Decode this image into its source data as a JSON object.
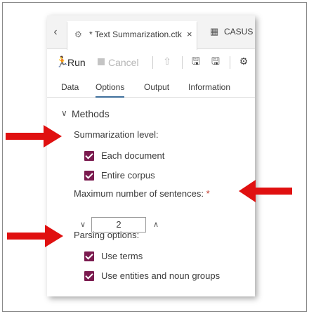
{
  "tabbar": {
    "prev_glyph": "‹",
    "active_tab": {
      "icon": "gear-doc-icon",
      "label": "* Text Summarization.ctk",
      "close_glyph": "×"
    },
    "second_tab": {
      "icon": "table-doc-icon",
      "label": "CASUS"
    }
  },
  "toolbar": {
    "run_label": "Run",
    "cancel_label": "Cancel",
    "icons": [
      "upload-icon",
      "save-icon",
      "save-as-icon",
      "settings-icon"
    ]
  },
  "subtabs": [
    {
      "label": "Data",
      "active": false
    },
    {
      "label": "Options",
      "active": true
    },
    {
      "label": "Output",
      "active": false
    },
    {
      "label": "Information",
      "active": false
    }
  ],
  "options": {
    "section_label": "Methods",
    "summarization_level": {
      "label": "Summarization level:",
      "choices": [
        {
          "label": "Each document",
          "checked": true
        },
        {
          "label": "Entire corpus",
          "checked": true
        }
      ]
    },
    "max_sentences": {
      "label": "Maximum number of sentences:",
      "required_mark": "*",
      "value": "2"
    },
    "parsing_options": {
      "label": "Parsing options:",
      "choices": [
        {
          "label": "Use terms",
          "checked": true
        },
        {
          "label": "Use entities and noun groups",
          "checked": true
        }
      ]
    }
  },
  "colors": {
    "checkbox": "#7b1b4f",
    "annotation_arrow": "#e01010",
    "active_tab_underline": "#3f6f9c"
  }
}
